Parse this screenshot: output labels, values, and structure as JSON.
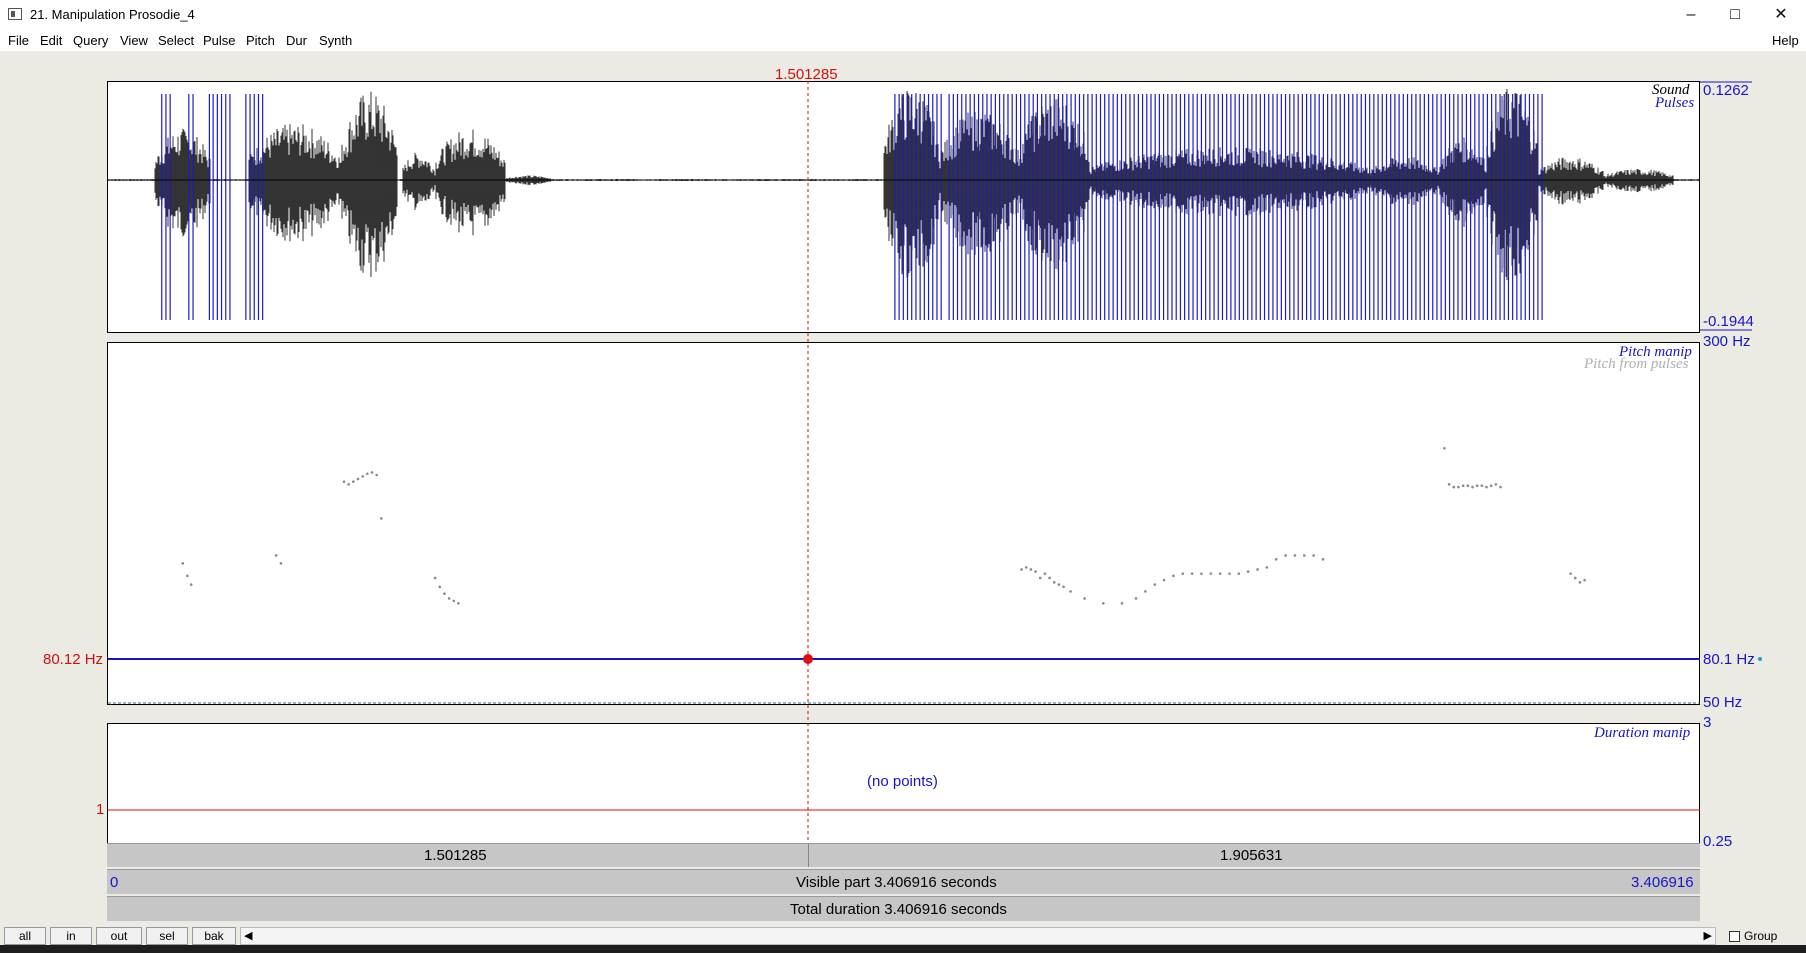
{
  "window": {
    "title": "21. Manipulation Prosodie_4",
    "minimize_icon": "minimize-icon",
    "maximize_icon": "maximize-icon",
    "close_icon": "close-icon"
  },
  "menu": {
    "items": [
      "File",
      "Edit",
      "Query",
      "View",
      "Select",
      "Pulse",
      "Pitch",
      "Dur",
      "Synth"
    ],
    "help": "Help"
  },
  "cursor": {
    "time_label": "1.501285"
  },
  "sound_panel": {
    "label_sound": "Sound",
    "label_pulses": "Pulses",
    "ymax": "0.1262",
    "ymin": "-0.1944"
  },
  "pitch_panel": {
    "label_manip": "Pitch manip",
    "label_from_pulses": "Pitch from pulses",
    "top": "300 Hz",
    "bottom": "50 Hz",
    "cursor_value_left": "80.12 Hz",
    "cursor_value_right": "80.1 Hz"
  },
  "duration_panel": {
    "label": "Duration manip",
    "top": "3",
    "one": "1",
    "bottom": "0.25",
    "empty_text": "(no points)"
  },
  "time_bars": {
    "left_segment": "1.501285",
    "right_segment": "1.905631",
    "start": "0",
    "visible": "Visible part 3.406916 seconds",
    "end": "3.406916",
    "total": "Total duration 3.406916 seconds"
  },
  "bottom_buttons": [
    "all",
    "in",
    "out",
    "sel",
    "bak"
  ],
  "group_label": "Group",
  "colors": {
    "blue": "#1616c8",
    "red": "#d01010",
    "pulse": "#1a1ad0",
    "grey": "#b0b0b0",
    "background": "#ecebe3"
  },
  "pulse_times_s": [
    0.115,
    0.124,
    0.133,
    0.173,
    0.182,
    0.217,
    0.225,
    0.234,
    0.243,
    0.252,
    0.261,
    0.295,
    0.304,
    0.313,
    0.322,
    0.331,
    1.684,
    1.693,
    1.702,
    1.711,
    1.72,
    1.729,
    1.738,
    1.747,
    1.756,
    1.765,
    1.774,
    1.783,
    1.8,
    1.809,
    1.818,
    1.827,
    1.836,
    1.845,
    1.854,
    1.863,
    1.872,
    1.881,
    1.89,
    1.899,
    1.908,
    1.917,
    1.926,
    1.935,
    1.944,
    1.953,
    1.962,
    1.971,
    1.98,
    1.989,
    1.998,
    2.007,
    2.016,
    2.025,
    2.034,
    2.043,
    2.052,
    2.061,
    2.07,
    2.079,
    2.088,
    2.097,
    2.106,
    2.115,
    2.124,
    2.133,
    2.142,
    2.151,
    2.16,
    2.169,
    2.178,
    2.187,
    2.196,
    2.205,
    2.214,
    2.223,
    2.232,
    2.241,
    2.25,
    2.259,
    2.268,
    2.277,
    2.286,
    2.295,
    2.304,
    2.313,
    2.322,
    2.331,
    2.34,
    2.349,
    2.358,
    2.367,
    2.376,
    2.385,
    2.394,
    2.403,
    2.412,
    2.421,
    2.43,
    2.439,
    2.448,
    2.457,
    2.466,
    2.475,
    2.484,
    2.493,
    2.502,
    2.511,
    2.52,
    2.529,
    2.538,
    2.547,
    2.556,
    2.565,
    2.574,
    2.583,
    2.592,
    2.601,
    2.61,
    2.619,
    2.628,
    2.637,
    2.646,
    2.655,
    2.664,
    2.673,
    2.682,
    2.691,
    2.7,
    2.709,
    2.718,
    2.727,
    2.736,
    2.745,
    2.754,
    2.763,
    2.772,
    2.781,
    2.79,
    2.799,
    2.808,
    2.817,
    2.826,
    2.835,
    2.844,
    2.853,
    2.862,
    2.871,
    2.88,
    2.889,
    2.898,
    2.907,
    2.916,
    2.925,
    2.934,
    2.943,
    2.952,
    2.961,
    2.97,
    2.979,
    2.988,
    2.997,
    3.006,
    3.015,
    3.024,
    3.033,
    3.042,
    3.051,
    3.06,
    3.069
  ],
  "pitch_points": [
    [
      0.16,
      100
    ],
    [
      0.17,
      94
    ],
    [
      0.178,
      90
    ],
    [
      0.36,
      104
    ],
    [
      0.37,
      100
    ],
    [
      0.505,
      150
    ],
    [
      0.515,
      148
    ],
    [
      0.525,
      150
    ],
    [
      0.535,
      152
    ],
    [
      0.545,
      154
    ],
    [
      0.555,
      156
    ],
    [
      0.565,
      157
    ],
    [
      0.575,
      155
    ],
    [
      0.585,
      125
    ],
    [
      0.7,
      93
    ],
    [
      0.71,
      89
    ],
    [
      0.72,
      86
    ],
    [
      0.73,
      84
    ],
    [
      0.74,
      83
    ],
    [
      0.75,
      82
    ],
    [
      1.955,
      97
    ],
    [
      1.965,
      98
    ],
    [
      1.975,
      97
    ],
    [
      1.985,
      96
    ],
    [
      1.995,
      93
    ],
    [
      2.005,
      95
    ],
    [
      2.015,
      93
    ],
    [
      2.025,
      91
    ],
    [
      2.035,
      90
    ],
    [
      2.045,
      89
    ],
    [
      2.06,
      87
    ],
    [
      2.09,
      84
    ],
    [
      2.13,
      82
    ],
    [
      2.17,
      82
    ],
    [
      2.2,
      84
    ],
    [
      2.22,
      87
    ],
    [
      2.24,
      90
    ],
    [
      2.26,
      92
    ],
    [
      2.28,
      94
    ],
    [
      2.3,
      95
    ],
    [
      2.32,
      95
    ],
    [
      2.34,
      95
    ],
    [
      2.36,
      95
    ],
    [
      2.38,
      95
    ],
    [
      2.4,
      95
    ],
    [
      2.42,
      95
    ],
    [
      2.44,
      96
    ],
    [
      2.46,
      97
    ],
    [
      2.48,
      98
    ],
    [
      2.5,
      102
    ],
    [
      2.52,
      104
    ],
    [
      2.54,
      104
    ],
    [
      2.56,
      104
    ],
    [
      2.58,
      104
    ],
    [
      2.6,
      102
    ],
    [
      2.86,
      177
    ],
    [
      2.87,
      148
    ],
    [
      2.88,
      146
    ],
    [
      2.89,
      146
    ],
    [
      2.9,
      147
    ],
    [
      2.91,
      147
    ],
    [
      2.92,
      146
    ],
    [
      2.93,
      147
    ],
    [
      2.94,
      147
    ],
    [
      2.95,
      146
    ],
    [
      2.96,
      147
    ],
    [
      2.97,
      148
    ],
    [
      2.98,
      146
    ],
    [
      3.13,
      95
    ],
    [
      3.14,
      93
    ],
    [
      3.15,
      91
    ],
    [
      3.16,
      92
    ]
  ],
  "pitch_manip_value_hz": 80.12
}
